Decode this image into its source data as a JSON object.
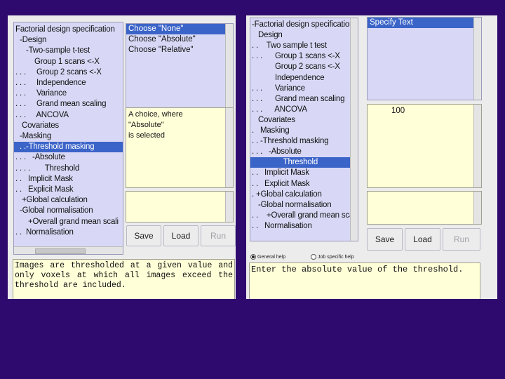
{
  "left_window": {
    "tree": [
      {
        "text": "Factorial design specification",
        "selected": false
      },
      {
        "text": "  -Design",
        "selected": false
      },
      {
        "text": "     -Two-sample t-test",
        "selected": false
      },
      {
        "text": "         Group 1 scans <-X",
        "selected": false
      },
      {
        "text": ". . .     Group 2 scans <-X",
        "selected": false
      },
      {
        "text": ". . .     Independence",
        "selected": false
      },
      {
        "text": ". . .     Variance",
        "selected": false
      },
      {
        "text": ". . .     Grand mean scaling",
        "selected": false
      },
      {
        "text": ". . .     ANCOVA",
        "selected": false
      },
      {
        "text": "   Covariates",
        "selected": false
      },
      {
        "text": "  -Masking",
        "selected": false
      },
      {
        "text": "  . .-Threshold masking",
        "selected": true
      },
      {
        "text": ". . .   -Absolute",
        "selected": false
      },
      {
        "text": ". . . .       Threshold",
        "selected": false
      },
      {
        "text": ". .   Implicit Mask",
        "selected": false
      },
      {
        "text": ". .   Explicit Mask",
        "selected": false
      },
      {
        "text": "   +Global calculation",
        "selected": false
      },
      {
        "text": "  -Global normalisation",
        "selected": false
      },
      {
        "text": "      +Overall grand mean scali",
        "selected": false
      },
      {
        "text": ". .  Normalisation",
        "selected": false
      }
    ],
    "choices": [
      {
        "text": "Choose \"None\"",
        "selected": true
      },
      {
        "text": "Choose \"Absolute\"",
        "selected": false
      },
      {
        "text": "Choose \"Relative\"",
        "selected": false
      }
    ],
    "info": [
      "A choice, where",
      "\"Absolute\"",
      "is selected"
    ],
    "buttons": {
      "save": "Save",
      "load": "Load",
      "run": "Run"
    },
    "help_text": "Images are thresholded at a given value and only voxels at which all images exceed the threshold are included."
  },
  "right_window": {
    "tree": [
      {
        "text": "-Factorial design specification",
        "selected": false
      },
      {
        "text": "   Design",
        "selected": false
      },
      {
        "text": ". .    Two sample t test",
        "selected": false
      },
      {
        "text": ". . .      Group 1 scans <-X",
        "selected": false
      },
      {
        "text": "           Group 2 scans <-X",
        "selected": false
      },
      {
        "text": "           Independence",
        "selected": false
      },
      {
        "text": ". . .      Variance",
        "selected": false
      },
      {
        "text": ". . .      Grand mean scaling",
        "selected": false
      },
      {
        "text": ". . .      ANCOVA",
        "selected": false
      },
      {
        "text": "   Covariates",
        "selected": false
      },
      {
        "text": ".   Masking",
        "selected": false
      },
      {
        "text": ". . -Threshold masking",
        "selected": false
      },
      {
        "text": ". . .   -Absolute",
        "selected": false
      },
      {
        "text": "               Threshold",
        "selected": true
      },
      {
        "text": ". .   Implicit Mask",
        "selected": false
      },
      {
        "text": ". .   Explicit Mask",
        "selected": false
      },
      {
        "text": ". +Global calculation",
        "selected": false
      },
      {
        "text": "   -Global normalisation",
        "selected": false
      },
      {
        "text": ". .    +Overall grand mean scali",
        "selected": false
      },
      {
        "text": ". .   Normalisation",
        "selected": false
      }
    ],
    "choices": [
      {
        "text": "Specify Text",
        "selected": true
      }
    ],
    "value": "100",
    "buttons": {
      "save": "Save",
      "load": "Load",
      "run": "Run"
    },
    "help_mode": {
      "general": "General help",
      "job": "Job specific help",
      "selected": "general"
    },
    "help_text": "Enter the absolute value of the threshold."
  },
  "colors": {
    "background": "#2e0a6e",
    "selection": "#3b64c8",
    "tree_bg": "#d8d8f6",
    "yellow_bg": "#ffffd8"
  }
}
